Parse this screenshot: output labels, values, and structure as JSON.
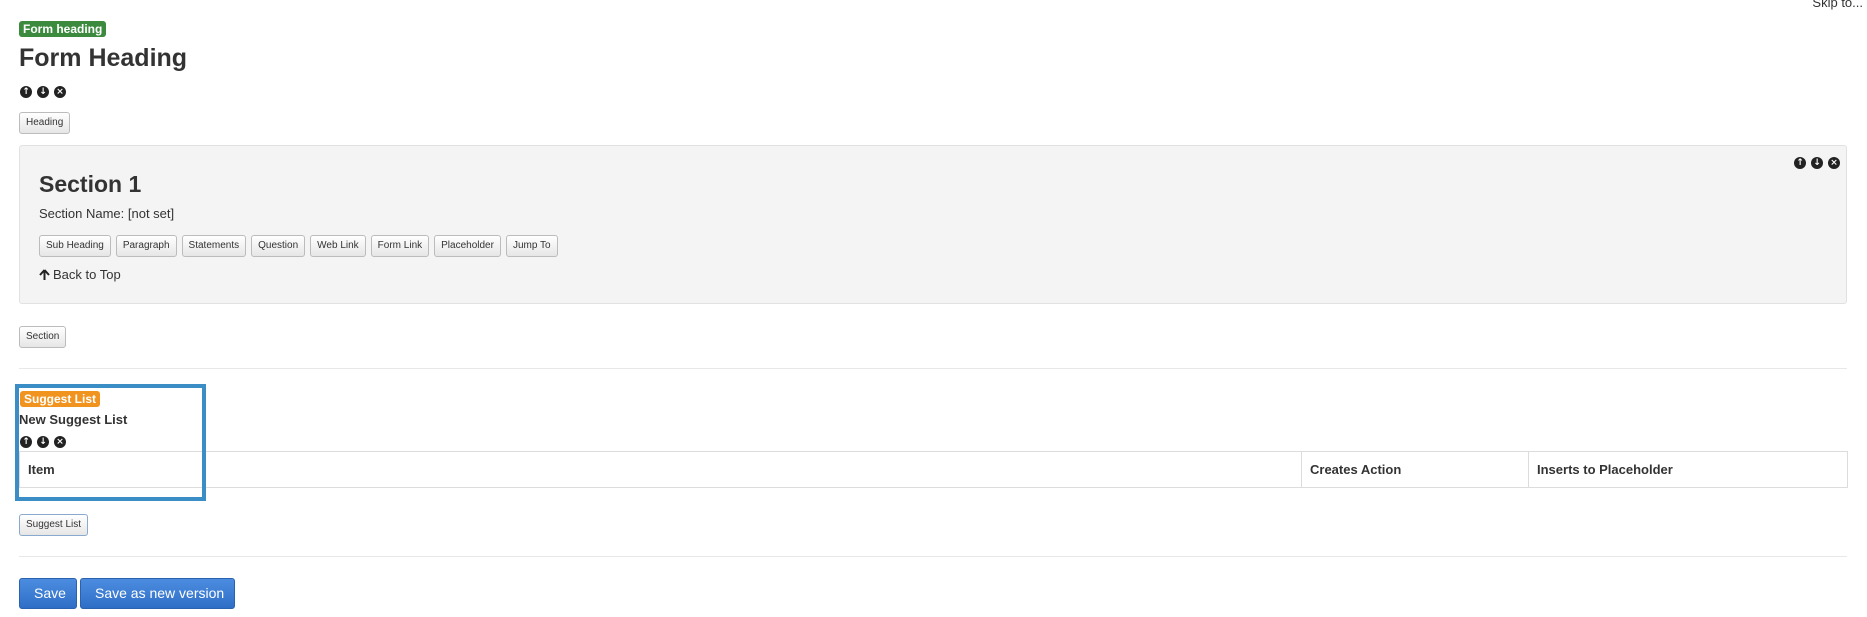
{
  "skip_link": "Skip to...",
  "form_heading": {
    "badge": "Form heading",
    "title": "Form Heading",
    "add_button": "Heading"
  },
  "section": {
    "title": "Section 1",
    "name_label": "Section Name: [not set]",
    "buttons": [
      "Sub Heading",
      "Paragraph",
      "Statements",
      "Question",
      "Web Link",
      "Form Link",
      "Placeholder",
      "Jump To"
    ],
    "back_to_top": "Back to Top",
    "add_button": "Section"
  },
  "suggest_list": {
    "badge": "Suggest List",
    "title": "New Suggest List",
    "columns": [
      "Item",
      "Creates Action",
      "Inserts to Placeholder"
    ],
    "add_button": "Suggest List"
  },
  "footer": {
    "save": "Save",
    "save_new_version": "Save as new version"
  },
  "colors": {
    "form_heading_badge": "#3b8a3e",
    "suggest_list_badge": "#f0931f",
    "selection_outline": "#3a8dc5",
    "primary_button": "#2e6ec6"
  },
  "icons": {
    "move_up": "up-arrow-circle-icon",
    "move_down": "down-arrow-circle-icon",
    "remove": "remove-circle-icon"
  }
}
